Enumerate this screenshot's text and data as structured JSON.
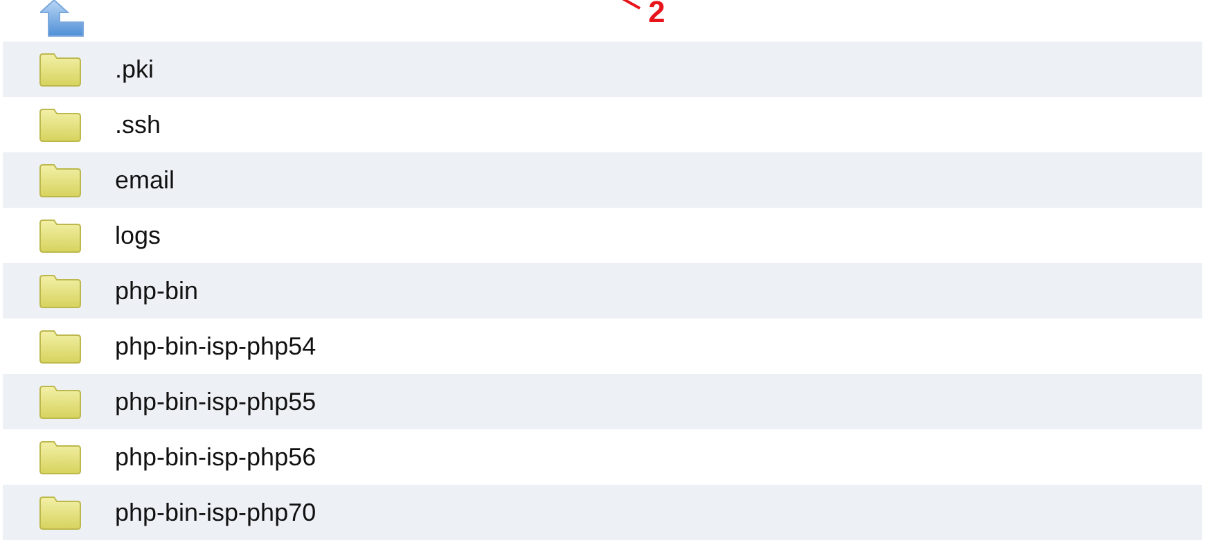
{
  "annotation": {
    "label": "2"
  },
  "folders": [
    {
      "name": ".pki"
    },
    {
      "name": ".ssh"
    },
    {
      "name": "email"
    },
    {
      "name": "logs"
    },
    {
      "name": "php-bin"
    },
    {
      "name": "php-bin-isp-php54"
    },
    {
      "name": "php-bin-isp-php55"
    },
    {
      "name": "php-bin-isp-php56"
    },
    {
      "name": "php-bin-isp-php70"
    }
  ]
}
